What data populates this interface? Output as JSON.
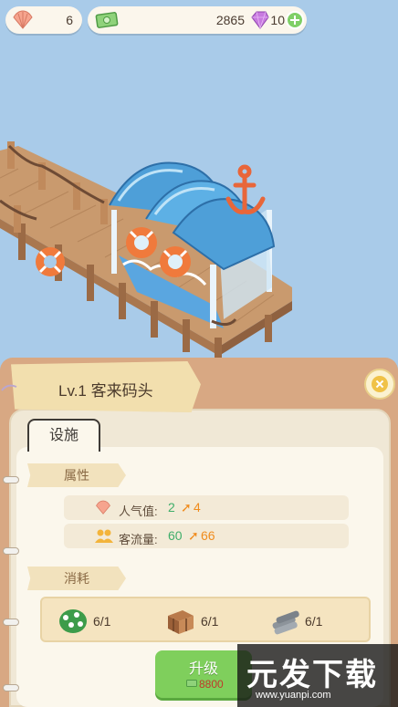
{
  "resources": {
    "shells": "6",
    "cash": "2865",
    "gems": "10",
    "plus_icon": "plus-icon"
  },
  "panel": {
    "title": "Lv.1 客来码头",
    "tab_label": "设施",
    "attributes_label": "属性",
    "popularity_label": "人气值:",
    "popularity_current": "2",
    "popularity_next": "4",
    "flow_label": "客流量:",
    "flow_current": "60",
    "flow_next": "66",
    "cost_label": "消耗",
    "costs": [
      {
        "icon": "tree-bush-icon",
        "value": "6/1"
      },
      {
        "icon": "wood-crate-icon",
        "value": "6/1"
      },
      {
        "icon": "steel-pipe-icon",
        "value": "6/1"
      }
    ],
    "upgrade_label": "升级",
    "upgrade_cost": "8800"
  },
  "watermark": {
    "main": "元发下载",
    "site": "www.yuanpi.com"
  },
  "colors": {
    "sea": "#a9cbe9",
    "panel_wood": "#d8a883",
    "upgrade_green": "#7fcf5c",
    "stat_green": "#3fae6a",
    "stat_orange": "#f08c1e"
  }
}
